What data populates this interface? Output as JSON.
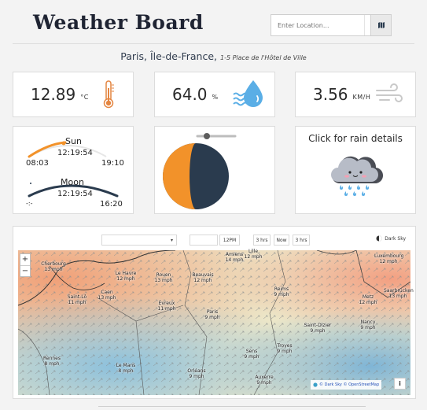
{
  "app": {
    "title": "Weather Board"
  },
  "search": {
    "placeholder": "Enter Location..."
  },
  "location": {
    "city": "Paris, Île-de-France,",
    "address": "1-5 Place de l'Hôtel de Ville"
  },
  "metrics": {
    "temperature": {
      "value": "12.89",
      "unit": "°C"
    },
    "humidity": {
      "value": "64.0",
      "unit": "%"
    },
    "wind": {
      "value": "3.56",
      "unit": "KM/H"
    }
  },
  "sun": {
    "label": "Sun",
    "now": "12:19:54",
    "rise": "08:03",
    "set": "19:10"
  },
  "moon": {
    "label": "Moon",
    "now": "12:19:54",
    "rise": "-:-",
    "set": "16:20"
  },
  "moon_phase": {
    "illumination_fraction": 0.5
  },
  "rain": {
    "label": "Click for rain details"
  },
  "map": {
    "time_label": "12PM",
    "btn_3hrs_back": "3 hrs",
    "btn_now": "Now",
    "btn_3hrs_fwd": "3 hrs",
    "darksky_label": "Dark Sky",
    "attribution": "© Dark Sky © OpenStreetMap",
    "zoom_in": "+",
    "zoom_out": "−",
    "info": "i",
    "cities": [
      {
        "name": "Cherbourg",
        "wind": "13 mph"
      },
      {
        "name": "Le Havre",
        "wind": "12 mph"
      },
      {
        "name": "Rouen",
        "wind": "13 mph"
      },
      {
        "name": "Beauvais",
        "wind": "12 mph"
      },
      {
        "name": "Saint-Lô",
        "wind": "11 mph"
      },
      {
        "name": "Caen",
        "wind": "13 mph"
      },
      {
        "name": "Évreux",
        "wind": "11 mph"
      },
      {
        "name": "Paris",
        "wind": "9 mph"
      },
      {
        "name": "Reims",
        "wind": "9 mph"
      },
      {
        "name": "Metz",
        "wind": "12 mph"
      },
      {
        "name": "Nancy",
        "wind": "9 mph"
      },
      {
        "name": "Saint-Dizier",
        "wind": "9 mph"
      },
      {
        "name": "Troyes",
        "wind": "9 mph"
      },
      {
        "name": "Sens",
        "wind": "9 mph"
      },
      {
        "name": "Rennes",
        "wind": "8 mph"
      },
      {
        "name": "Le Mans",
        "wind": "8 mph"
      },
      {
        "name": "Orléans",
        "wind": "9 mph"
      },
      {
        "name": "Auxerre",
        "wind": "9 mph"
      },
      {
        "name": "Saarbrücken",
        "wind": "13 mph"
      },
      {
        "name": "Amiens",
        "wind": "14 mph"
      },
      {
        "name": "Lille",
        "wind": "12 mph"
      },
      {
        "name": "Luxembourg",
        "wind": "12 mph"
      }
    ]
  },
  "colors": {
    "sun_arc": "#f2922a",
    "moon_arc": "#2a3b4e",
    "moon_light": "#f2922a",
    "moon_dark": "#2a3b4e",
    "drop_blue": "#5aaee6"
  }
}
